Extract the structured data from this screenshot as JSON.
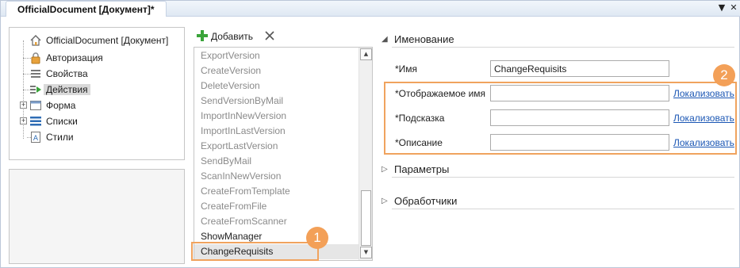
{
  "window": {
    "tab_title": "OfficialDocument [Документ]*",
    "menu_icon": "chevron-down-icon",
    "close_icon": "close-icon"
  },
  "tree": {
    "items": [
      {
        "label": "OfficialDocument [Документ]",
        "icon": "house-icon"
      },
      {
        "label": "Авторизация",
        "icon": "lock-icon"
      },
      {
        "label": "Свойства",
        "icon": "properties-list-icon"
      },
      {
        "label": "Действия",
        "icon": "actions-list-icon"
      },
      {
        "label": "Форма",
        "icon": "form-icon"
      },
      {
        "label": "Списки",
        "icon": "lists-icon"
      },
      {
        "label": "Стили",
        "icon": "styles-icon"
      }
    ],
    "selected": "Действия"
  },
  "toolbar": {
    "add_label": "Добавить",
    "add_icon": "plus-icon",
    "delete_icon": "delete-x-icon"
  },
  "actions_list": {
    "items": [
      "ExportVersion",
      "CreateVersion",
      "DeleteVersion",
      "SendVersionByMail",
      "ImportInNewVersion",
      "ImportInLastVersion",
      "ExportLastVersion",
      "SendByMail",
      "ScanInNewVersion",
      "CreateFromTemplate",
      "CreateFromFile",
      "CreateFromScanner",
      "ShowManager",
      "ChangeRequisits"
    ],
    "selected": "ChangeRequisits"
  },
  "properties": {
    "naming_section": "Именование",
    "name_label": "*Имя",
    "name_value": "ChangeRequisits",
    "display_name_label": "*Отображаемое имя",
    "display_name_value": "",
    "hint_label": "*Подсказка",
    "hint_value": "",
    "description_label": "*Описание",
    "description_value": "",
    "localize_label": "Локализовать",
    "parameters_section": "Параметры",
    "handlers_section": "Обработчики"
  },
  "callouts": {
    "badge_1": "1",
    "badge_2": "2"
  },
  "colors": {
    "callout_orange": "#f3a058",
    "link_blue": "#1a56b4",
    "add_green": "#3aa43a"
  }
}
